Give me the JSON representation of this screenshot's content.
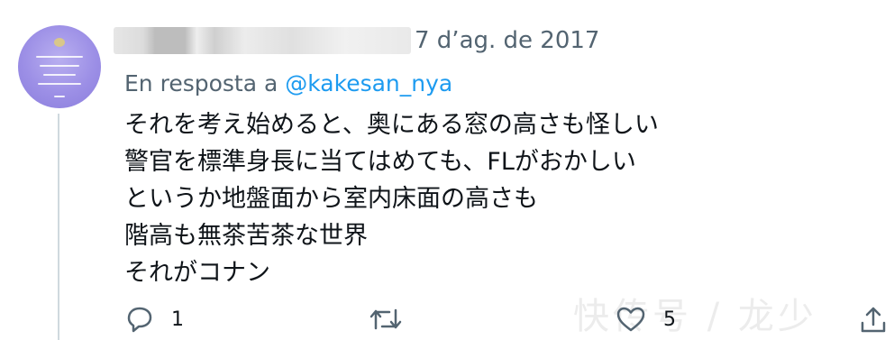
{
  "tweet": {
    "date": "7 d’ag. de 2017",
    "reply_prefix": "En resposta a",
    "reply_handle": "@kakesan_nya",
    "lines": [
      "それを考え始めると、奥にある窓の高さも怪しい",
      "警官を標準身長に当てはめても、FLがおかしい",
      "というか地盤面から室内床面の高さも",
      "階高も無茶苦茶な世界",
      "それがコナン"
    ]
  },
  "actions": {
    "reply_icon": "reply-icon",
    "reply_count": "1",
    "retweet_icon": "retweet-icon",
    "like_icon": "heart-icon",
    "like_count": "5",
    "share_icon": "share-icon"
  },
  "watermark": "快传号 / 龙少",
  "colors": {
    "accent": "#1d9bf0",
    "secondary_text": "#536471",
    "avatar": "#9c8fe6"
  }
}
